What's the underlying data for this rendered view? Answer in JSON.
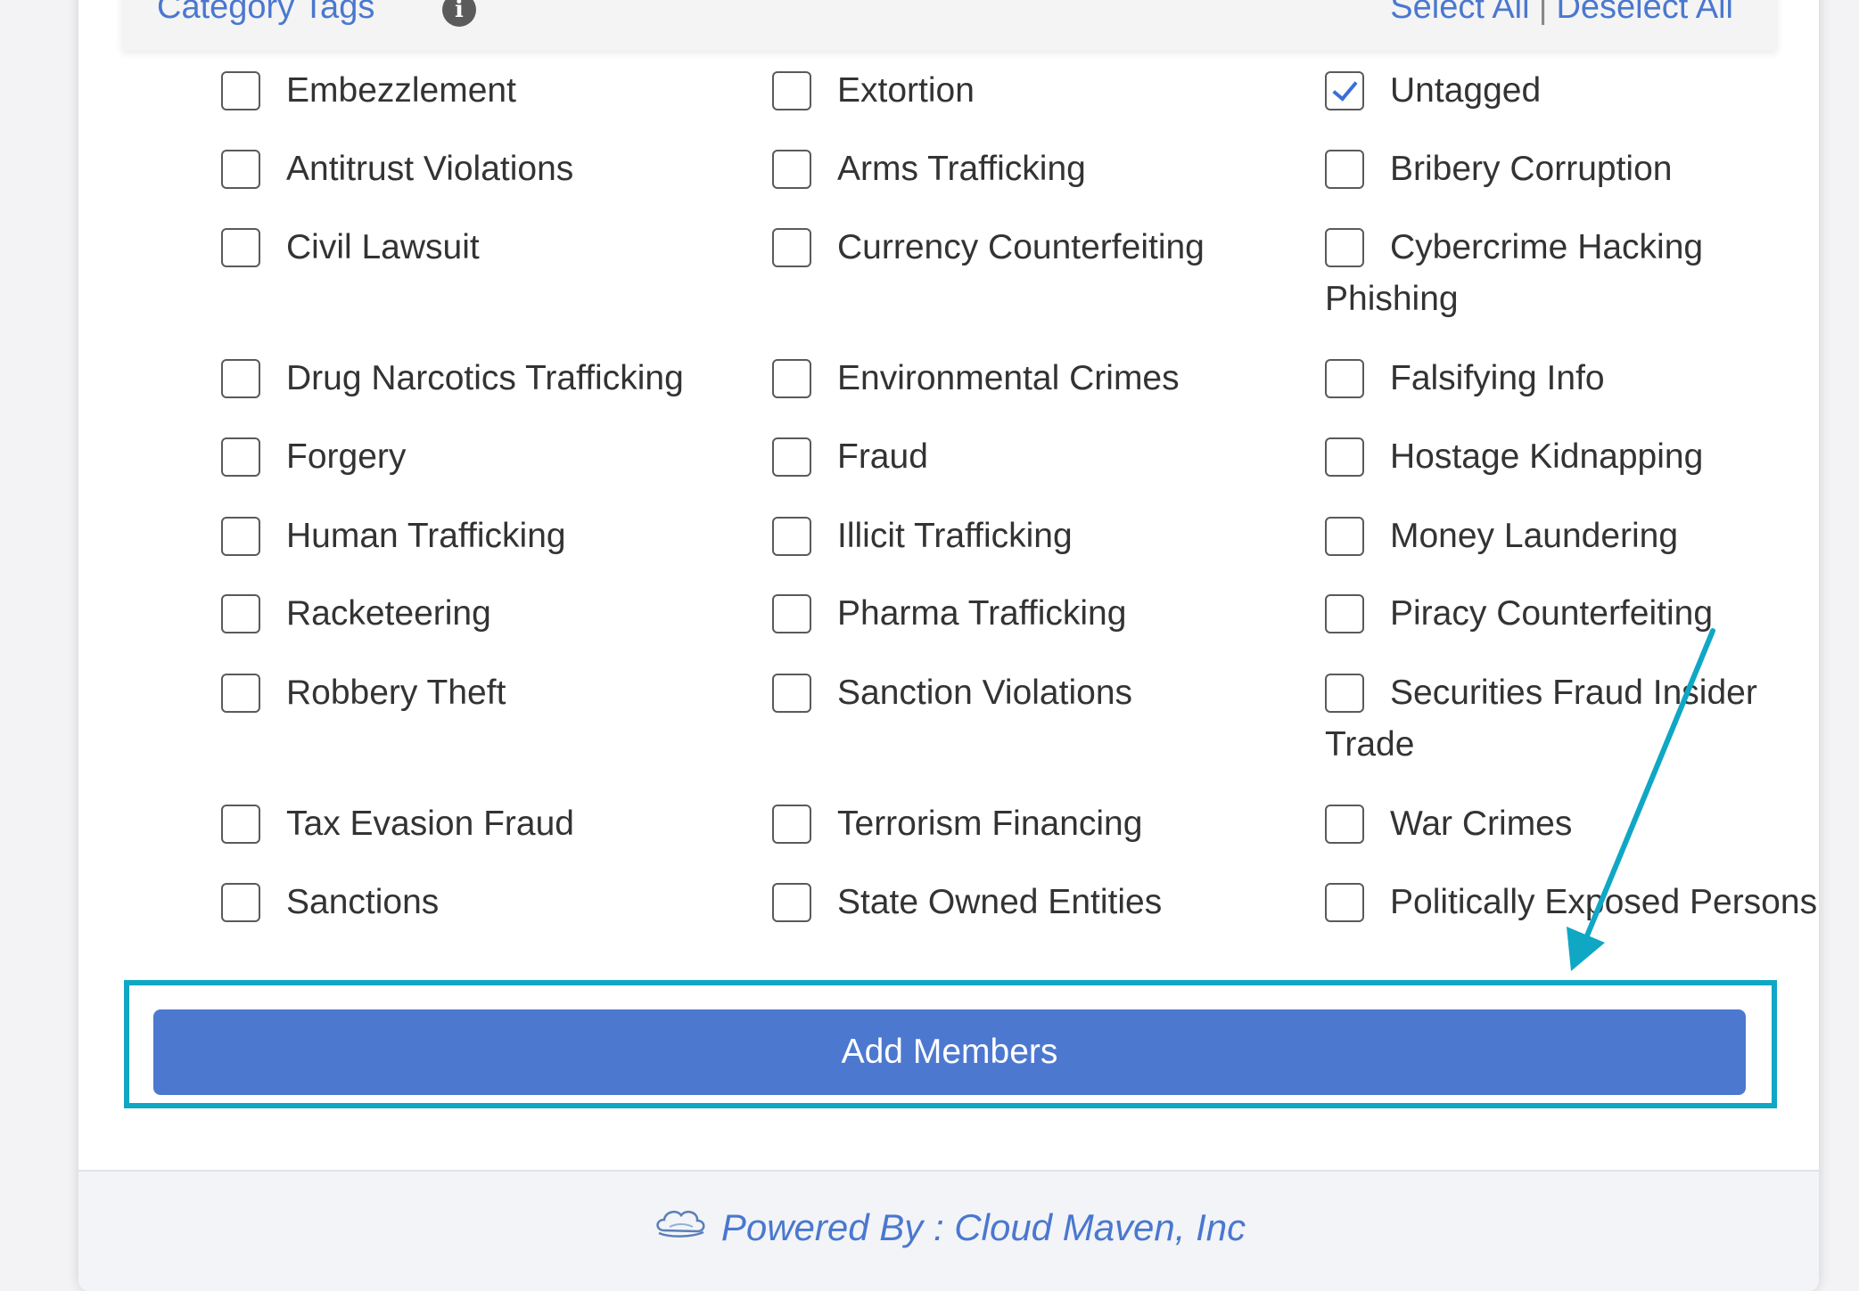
{
  "section": {
    "title": "Category Tags",
    "select_all": "Select All",
    "separator": "|",
    "deselect_all": "Deselect All"
  },
  "tags": [
    {
      "label": "Embezzlement",
      "checked": false
    },
    {
      "label": "Extortion",
      "checked": false
    },
    {
      "label": "Untagged",
      "checked": true
    },
    {
      "label": "Antitrust Violations",
      "checked": false
    },
    {
      "label": "Arms Trafficking",
      "checked": false
    },
    {
      "label": "Bribery Corruption",
      "checked": false
    },
    {
      "label": "Civil Lawsuit",
      "checked": false
    },
    {
      "label": "Currency Counterfeiting",
      "checked": false
    },
    {
      "label": "Cybercrime Hacking",
      "label_line2": "Phishing",
      "checked": false
    },
    {
      "label": "Drug Narcotics Trafficking",
      "checked": false
    },
    {
      "label": "Environmental Crimes",
      "checked": false
    },
    {
      "label": "Falsifying Info",
      "checked": false
    },
    {
      "label": "Forgery",
      "checked": false
    },
    {
      "label": "Fraud",
      "checked": false
    },
    {
      "label": "Hostage Kidnapping",
      "checked": false
    },
    {
      "label": "Human Trafficking",
      "checked": false
    },
    {
      "label": "Illicit Trafficking",
      "checked": false
    },
    {
      "label": "Money Laundering",
      "checked": false
    },
    {
      "label": "Racketeering",
      "checked": false
    },
    {
      "label": "Pharma Trafficking",
      "checked": false
    },
    {
      "label": "Piracy Counterfeiting",
      "checked": false
    },
    {
      "label": "Robbery Theft",
      "checked": false
    },
    {
      "label": "Sanction Violations",
      "checked": false
    },
    {
      "label": "Securities Fraud Insider",
      "label_line2": "Trade",
      "checked": false
    },
    {
      "label": "Tax Evasion Fraud",
      "checked": false
    },
    {
      "label": "Terrorism Financing",
      "checked": false
    },
    {
      "label": "War Crimes",
      "checked": false
    },
    {
      "label": "Sanctions",
      "checked": false
    },
    {
      "label": "State Owned Entities",
      "checked": false
    },
    {
      "label": "Politically Exposed Persons",
      "checked": false
    }
  ],
  "add_button": {
    "label": "Add Members"
  },
  "footer": {
    "text": "Powered By : Cloud Maven, Inc"
  },
  "colors": {
    "accent": "#4c78d0",
    "link": "#4a78cf",
    "highlight": "#0fa7c4",
    "checkmark": "#3a6fd8"
  },
  "icons": {
    "info": "info-icon",
    "cloud": "cloud-logo-icon",
    "annotation": "annotation-arrow"
  }
}
